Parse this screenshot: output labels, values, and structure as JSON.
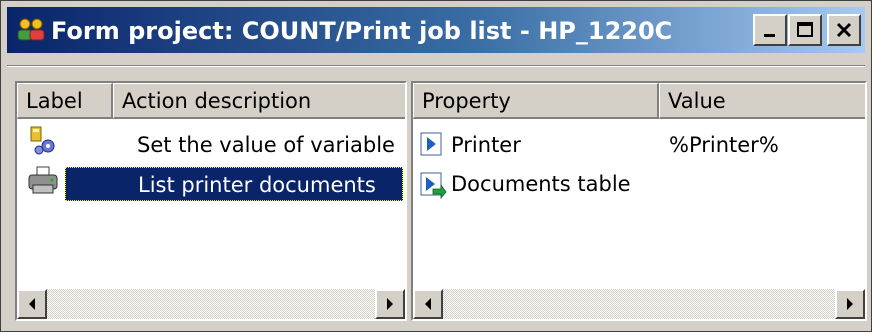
{
  "window": {
    "title": "Form project: COUNT/Print job list - HP_1220C",
    "title_icon": "users-group-icon",
    "controls": {
      "minimize": "minimize-icon",
      "maximize": "maximize-icon",
      "close": "close-icon"
    }
  },
  "actions_pane": {
    "columns": [
      "Label",
      "Action description"
    ],
    "rows": [
      {
        "label": "",
        "icon": "variable-gears-icon",
        "description": "Set the value of variable",
        "selected": false
      },
      {
        "label": "",
        "icon": "printer-icon",
        "description": "List printer documents",
        "selected": true
      }
    ]
  },
  "properties_pane": {
    "columns": [
      "Property",
      "Value"
    ],
    "rows": [
      {
        "icon": "input-parameter-icon",
        "property": "Printer",
        "value": "%Printer%"
      },
      {
        "icon": "output-parameter-icon",
        "property": "Documents table",
        "value": ""
      }
    ]
  },
  "colors": {
    "selection": "#0a246a",
    "title_start": "#0a246a",
    "title_end": "#a6caf0",
    "face": "#d4d0c8"
  }
}
